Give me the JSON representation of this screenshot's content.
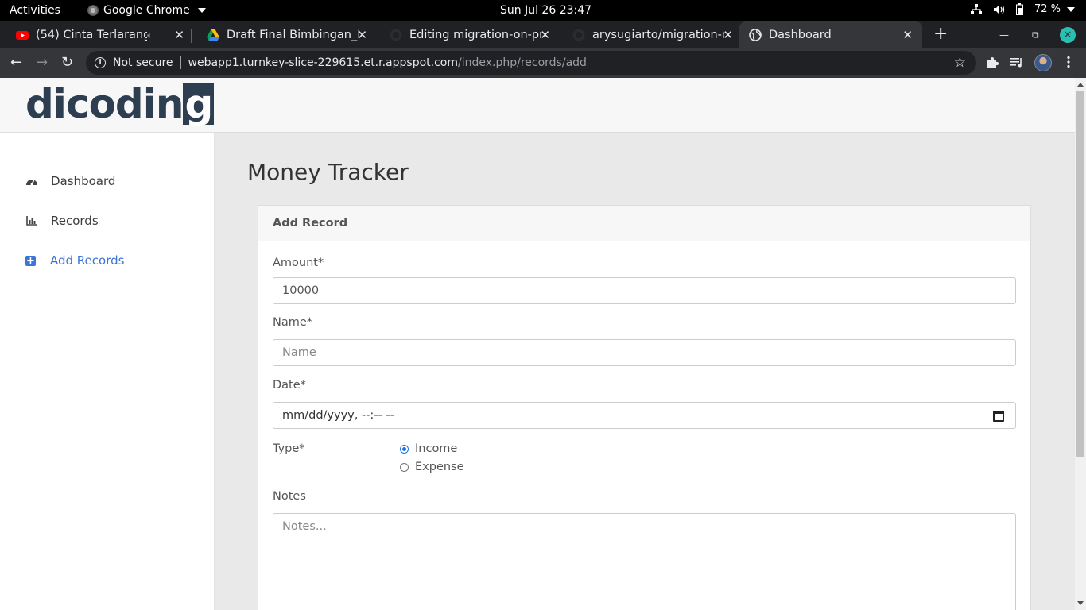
{
  "system_bar": {
    "activities": "Activities",
    "app_name": "Google Chrome",
    "clock": "Sun Jul 26  23:47",
    "battery": "72 %"
  },
  "tabs": [
    {
      "title": "(54) Cinta Terlarang -",
      "favicon": "youtube-icon"
    },
    {
      "title": "Draft Final Bimbingan_I",
      "favicon": "google-drive-icon"
    },
    {
      "title": "Editing migration-on-pre",
      "favicon": "github-icon"
    },
    {
      "title": "arysugiarto/migration-o",
      "favicon": "github-icon"
    },
    {
      "title": "Dashboard",
      "favicon": "globe-icon",
      "active": true
    }
  ],
  "address_bar": {
    "security": "Not secure",
    "host": "webapp1.turnkey-slice-229615.et.r.appspot.com",
    "path": "/index.php/records/add"
  },
  "sidebar": {
    "logo": "dicodin",
    "logo_last": "g",
    "items": [
      {
        "label": "Dashboard",
        "icon": "tachometer-icon"
      },
      {
        "label": "Records",
        "icon": "bar-chart-icon"
      },
      {
        "label": "Add Records",
        "icon": "plus-square-icon",
        "active": true
      }
    ]
  },
  "main": {
    "title": "Money Tracker",
    "card_title": "Add Record",
    "form": {
      "amount_label": "Amount*",
      "amount_value": "10000",
      "name_label": "Name*",
      "name_placeholder": "Name",
      "date_label": "Date*",
      "date_placeholder": "mm/dd/yyyy, --:-- --",
      "type_label": "Type*",
      "type_options": [
        "Income",
        "Expense"
      ],
      "type_selected": "Income",
      "notes_label": "Notes",
      "notes_placeholder": "Notes..."
    }
  },
  "colors": {
    "accent": "#3c75d6",
    "logo": "#2d3e50"
  }
}
